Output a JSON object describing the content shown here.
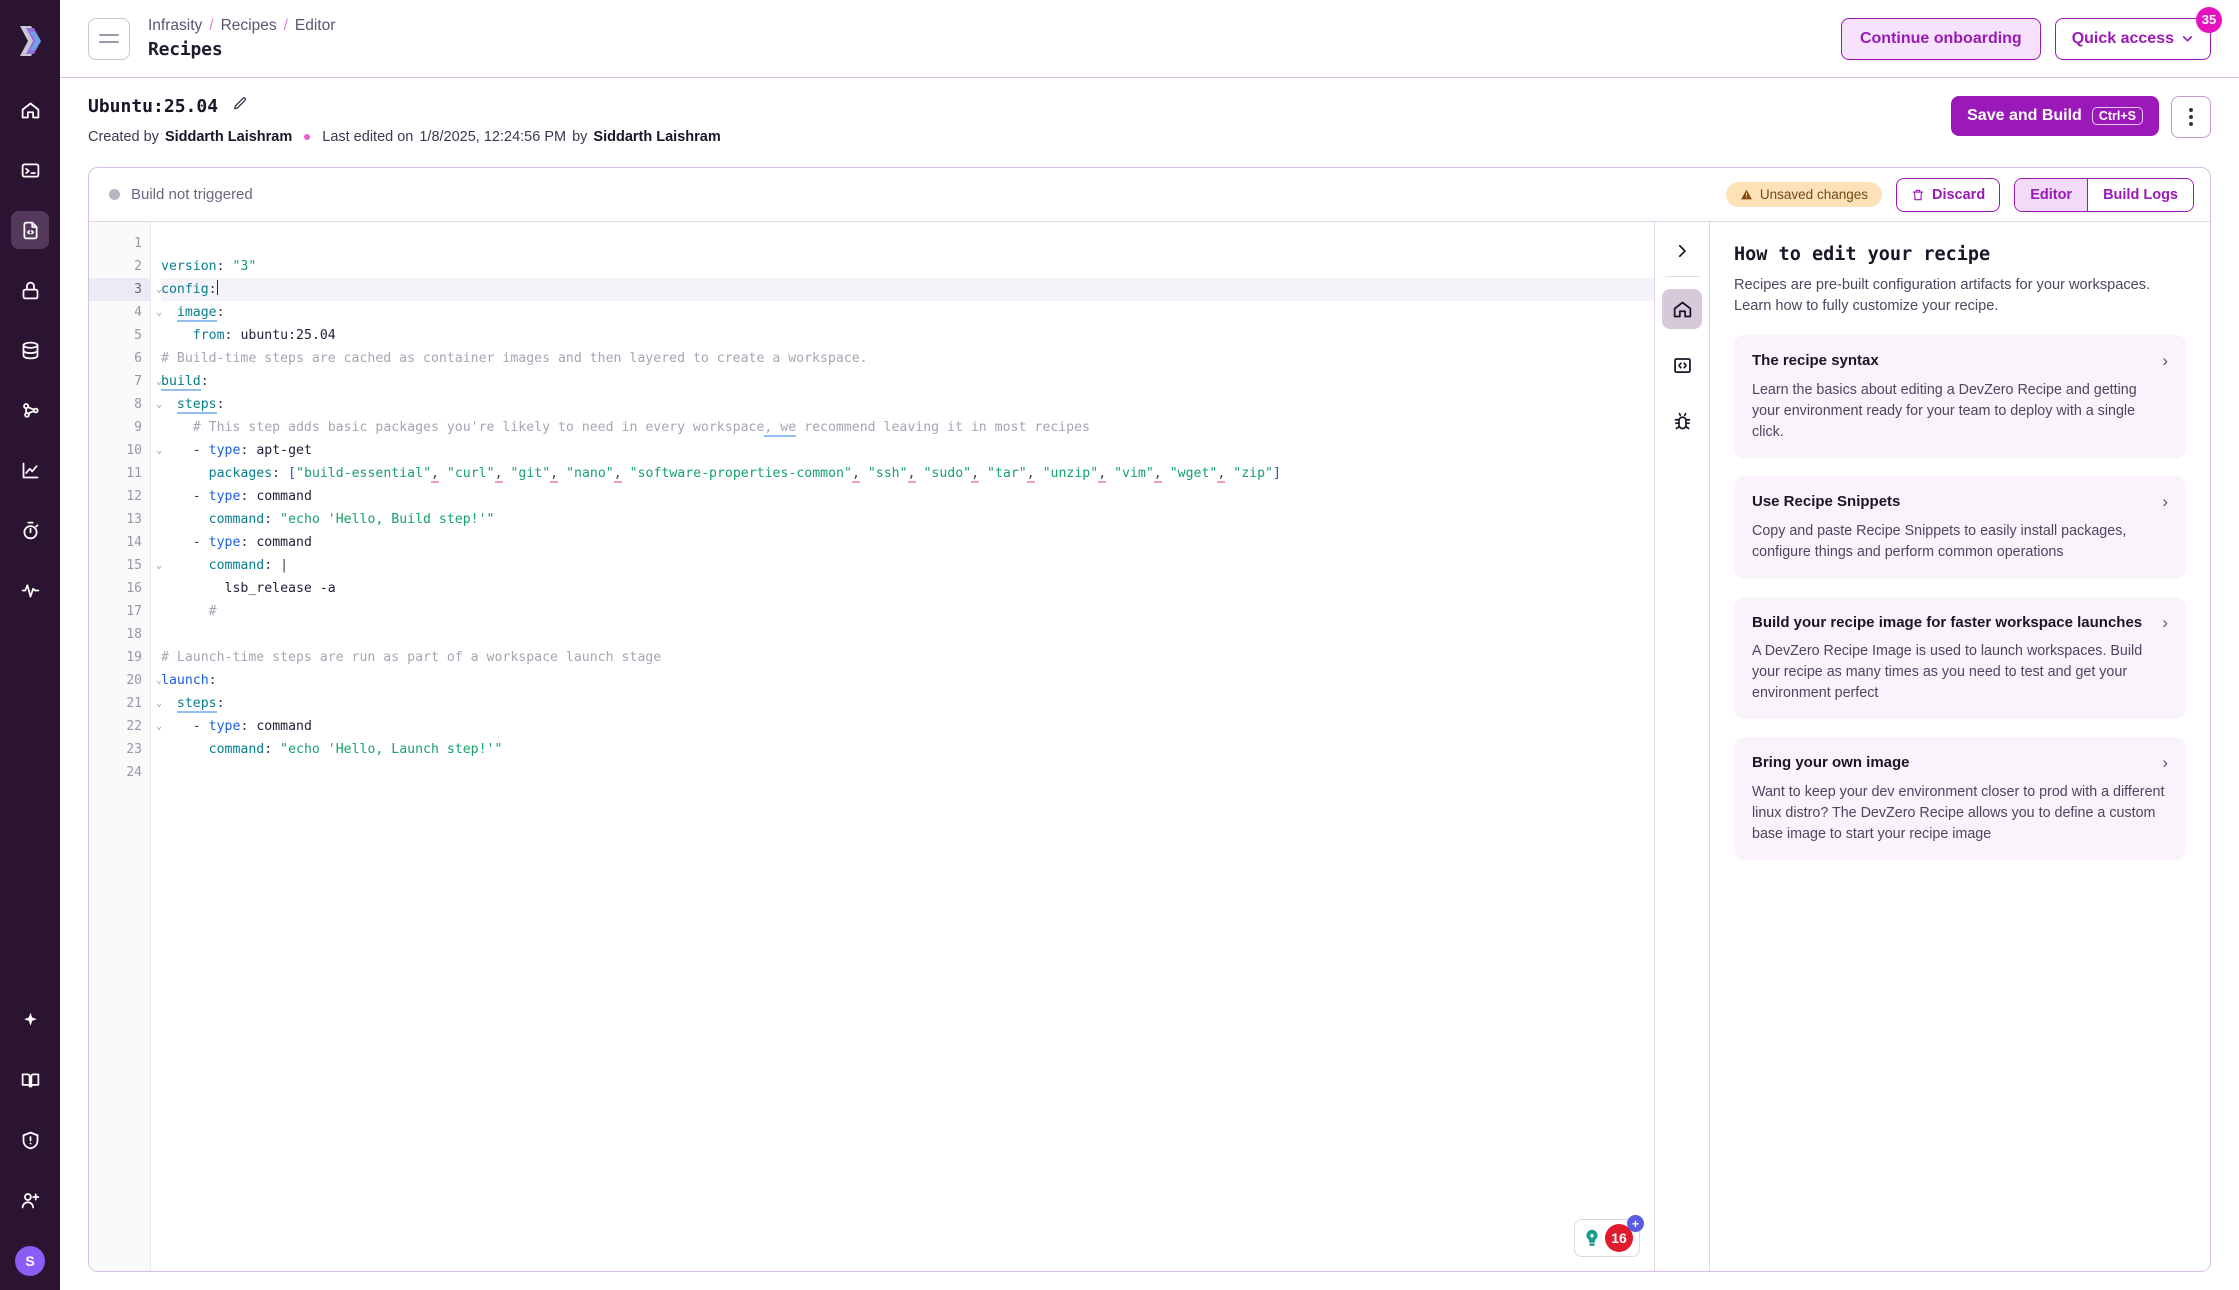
{
  "rail": {
    "logo_name": "devzero-logo",
    "items": [
      {
        "name": "home-icon",
        "label": "Home"
      },
      {
        "name": "terminal-icon",
        "label": "Workspaces"
      },
      {
        "name": "code-file-icon",
        "label": "Recipes",
        "active": true
      },
      {
        "name": "lock-icon",
        "label": "Secrets"
      },
      {
        "name": "database-icon",
        "label": "Databases"
      },
      {
        "name": "share-nodes-icon",
        "label": "Clusters"
      },
      {
        "name": "chart-line-icon",
        "label": "Insights"
      },
      {
        "name": "stopwatch-icon",
        "label": "Usage"
      },
      {
        "name": "activity-pulse-icon",
        "label": "Activity"
      }
    ],
    "bottom_items": [
      {
        "name": "sparkle-icon",
        "label": "AI"
      },
      {
        "name": "book-icon",
        "label": "Docs"
      },
      {
        "name": "shield-alert-icon",
        "label": "Support"
      },
      {
        "name": "add-user-icon",
        "label": "Invite"
      }
    ],
    "avatar_initial": "S"
  },
  "topbar": {
    "menu_icon": "hamburger-icon",
    "breadcrumb": [
      "Infrasity",
      "Recipes",
      "Editor"
    ],
    "breadcrumb_separator": "/",
    "title": "Recipes",
    "continue_onboarding_label": "Continue onboarding",
    "quick_access_label": "Quick access",
    "quick_access_badge": "35"
  },
  "recipe": {
    "name": "Ubuntu:25.04",
    "edit_icon": "pencil-icon",
    "created_by_prefix": "Created by",
    "created_by": "Siddarth Laishram",
    "last_edited_prefix": "Last edited on",
    "last_edited_at": "1/8/2025, 12:24:56 PM",
    "last_edited_by_prefix": "by",
    "last_edited_by": "Siddarth Laishram",
    "save_label": "Save and Build",
    "save_shortcut": "Ctrl+S",
    "kebab_icon": "more-vertical-icon"
  },
  "editor_bar": {
    "build_status": "Build not triggered",
    "unsaved_badge": "Unsaved changes",
    "warning_icon": "warning-triangle-icon",
    "discard_label": "Discard",
    "trash_icon": "trash-icon",
    "tabs": [
      {
        "label": "Editor",
        "active": true
      },
      {
        "label": "Build Logs",
        "active": false
      }
    ]
  },
  "code": {
    "current_line": 3,
    "total_lines": 24,
    "lines": [
      {
        "n": 1,
        "fold": false,
        "html": ""
      },
      {
        "n": 2,
        "fold": false,
        "html": "<span class=\"c-key\">version</span><span class=\"c-punc\">:</span> <span class=\"c-str\">\"3\"</span>"
      },
      {
        "n": 3,
        "fold": true,
        "html": "<span class=\"c-key\">config</span><span class=\"c-punc\">:</span><span class=\"caret\"></span>"
      },
      {
        "n": 4,
        "fold": true,
        "html": "  <span class=\"c-key u-blue\">image</span><span class=\"c-punc\">:</span>"
      },
      {
        "n": 5,
        "fold": false,
        "html": "    <span class=\"c-key\">from</span><span class=\"c-punc\">:</span> <span class=\"c-val\">ubuntu:25.04</span>"
      },
      {
        "n": 6,
        "fold": false,
        "html": "<span class=\"c-com\"># Build-time steps are cached as container images and then layered to create a workspace.</span>"
      },
      {
        "n": 7,
        "fold": true,
        "html": "<span class=\"c-key u-blue\">build</span><span class=\"c-punc\">:</span>"
      },
      {
        "n": 8,
        "fold": true,
        "html": "  <span class=\"c-key u-blue\">steps</span><span class=\"c-punc\">:</span>"
      },
      {
        "n": 9,
        "fold": false,
        "html": "    <span class=\"c-com\"># This step adds basic packages you're likely to need in every workspace<span class=\"u-blue\">, we</span> recommend leaving it in most recipes</span>"
      },
      {
        "n": 10,
        "fold": true,
        "html": "    <span class=\"c-punc\">-</span> <span class=\"c-key2\">type</span><span class=\"c-punc\">:</span> <span class=\"c-val\">apt-get</span>"
      },
      {
        "n": 11,
        "fold": false,
        "html": "      <span class=\"c-key\">packages</span><span class=\"c-punc\">:</span> <span class=\"c-brk\">[</span><span class=\"c-str\">\"build-essential\"</span><span class=\"c-punc u-red\">,</span> <span class=\"c-str\">\"curl\"</span><span class=\"c-punc u-red\">,</span> <span class=\"c-str\">\"git\"</span><span class=\"c-punc u-red\">,</span> <span class=\"c-str\">\"nano\"</span><span class=\"c-punc u-red\">,</span> <span class=\"c-str\">\"software-properties-common\"</span><span class=\"c-punc u-red\">,</span> <span class=\"c-str\">\"ssh\"</span><span class=\"c-punc u-red\">,</span> <span class=\"c-str\">\"sudo\"</span><span class=\"c-punc u-red\">,</span> <span class=\"c-str\">\"tar\"</span><span class=\"c-punc u-red\">,</span> <span class=\"c-str\">\"unzip\"</span><span class=\"c-punc u-red\">,</span> <span class=\"c-str\">\"vim\"</span><span class=\"c-punc u-red\">,</span> <span class=\"c-str\">\"wget\"</span><span class=\"c-punc u-red\">,</span> <span class=\"c-str\">\"zip\"</span><span class=\"c-brk\">]</span>"
      },
      {
        "n": 12,
        "fold": false,
        "html": "    <span class=\"c-punc\">-</span> <span class=\"c-key2\">type</span><span class=\"c-punc\">:</span> <span class=\"c-val\">command</span>"
      },
      {
        "n": 13,
        "fold": false,
        "html": "      <span class=\"c-key\">command</span><span class=\"c-punc\">:</span> <span class=\"c-str\">\"echo 'Hello, Build step!'\"</span>"
      },
      {
        "n": 14,
        "fold": false,
        "html": "    <span class=\"c-punc\">-</span> <span class=\"c-key2\">type</span><span class=\"c-punc\">:</span> <span class=\"c-val\">command</span>"
      },
      {
        "n": 15,
        "fold": true,
        "html": "      <span class=\"c-key\">command</span><span class=\"c-punc\">:</span> <span class=\"c-punc\">|</span>"
      },
      {
        "n": 16,
        "fold": false,
        "html": "        <span class=\"c-val\">lsb_release -a</span>"
      },
      {
        "n": 17,
        "fold": false,
        "html": "      <span class=\"c-com\">#</span>"
      },
      {
        "n": 18,
        "fold": false,
        "html": ""
      },
      {
        "n": 19,
        "fold": false,
        "html": "<span class=\"c-com\"># Launch-time steps are run as part of a workspace launch stage</span>"
      },
      {
        "n": 20,
        "fold": true,
        "html": "<span class=\"c-key2\">launch</span><span class=\"c-punc\">:</span>"
      },
      {
        "n": 21,
        "fold": true,
        "html": "  <span class=\"c-key u-blue\">steps</span><span class=\"c-punc\">:</span>"
      },
      {
        "n": 22,
        "fold": true,
        "html": "    <span class=\"c-punc\">-</span> <span class=\"c-key2\">type</span><span class=\"c-punc\">:</span> <span class=\"c-val\">command</span>"
      },
      {
        "n": 23,
        "fold": false,
        "html": "      <span class=\"c-key\">command</span><span class=\"c-punc\">:</span> <span class=\"c-str\">\"echo 'Hello, Launch step!'\"</span>"
      },
      {
        "n": 24,
        "fold": false,
        "html": ""
      }
    ],
    "status_badges": {
      "assistant_icon": "lightbulb-icon",
      "error_count": "16",
      "plus_icon": "plus-icon"
    }
  },
  "help_rail": {
    "collapse_icon": "chevron-right-icon",
    "items": [
      {
        "name": "home-icon",
        "active": true
      },
      {
        "name": "code-brackets-icon",
        "active": false
      },
      {
        "name": "bug-icon",
        "active": false
      }
    ]
  },
  "help_panel": {
    "title": "How to edit your recipe",
    "subtitle": "Recipes are pre-built configuration artifacts for your workspaces. Learn how to fully customize your recipe.",
    "cards": [
      {
        "title": "The recipe syntax",
        "body": "Learn the basics about editing a DevZero Recipe and getting your environment ready for your team to deploy with a single click."
      },
      {
        "title": "Use Recipe Snippets",
        "body": "Copy and paste Recipe Snippets to easily install packages, configure things and perform common operations"
      },
      {
        "title": "Build your recipe image for faster workspace launches",
        "body": "A DevZero Recipe Image is used to launch workspaces. Build your recipe as many times as you need to test and get your environment perfect"
      },
      {
        "title": "Bring your own image",
        "body": "Want to keep your dev environment closer to prod with a different linux distro? The DevZero Recipe allows you to define a custom base image to start your recipe image"
      }
    ],
    "chevron_icon": "chevron-right-icon"
  },
  "colors": {
    "rail_bg": "#2b1432",
    "accent_purple": "#9b19b8",
    "badge_pink": "#e612c0",
    "warning_bg": "#fce2b6",
    "avatar": "#8b5cf6"
  }
}
